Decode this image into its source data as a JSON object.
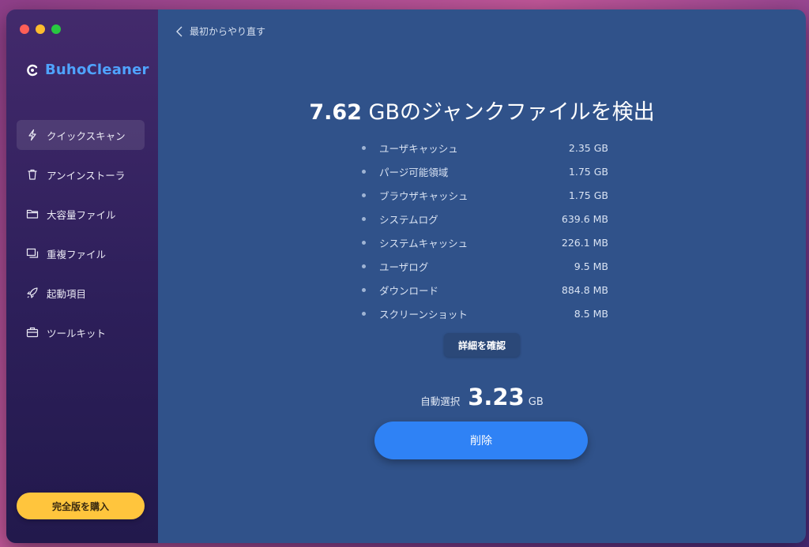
{
  "app": {
    "name": "BuhoCleaner"
  },
  "colors": {
    "brand": "#4fa3ff",
    "primary_button": "#2f82f5",
    "buy_button": "#ffc53d"
  },
  "sidebar": {
    "items": [
      {
        "label": "クイックスキャン",
        "icon": "pulse-icon",
        "active": true
      },
      {
        "label": "アンインストーラ",
        "icon": "trash-icon",
        "active": false
      },
      {
        "label": "大容量ファイル",
        "icon": "folder-icon",
        "active": false
      },
      {
        "label": "重複ファイル",
        "icon": "duplicate-icon",
        "active": false
      },
      {
        "label": "起動項目",
        "icon": "rocket-icon",
        "active": false
      },
      {
        "label": "ツールキット",
        "icon": "toolbox-icon",
        "active": false
      }
    ],
    "buy_label": "完全版を購入"
  },
  "main": {
    "back_label": "最初からやり直す",
    "headline_value": "7.62",
    "headline_text": " GBのジャンクファイルを検出",
    "junk_items": [
      {
        "name": "ユーザキャッシュ",
        "size": "2.35 GB"
      },
      {
        "name": "パージ可能領域",
        "size": "1.75 GB"
      },
      {
        "name": "ブラウザキャッシュ",
        "size": "1.75 GB"
      },
      {
        "name": "システムログ",
        "size": "639.6 MB"
      },
      {
        "name": "システムキャッシュ",
        "size": "226.1 MB"
      },
      {
        "name": "ユーザログ",
        "size": "9.5 MB"
      },
      {
        "name": "ダウンロード",
        "size": "884.8 MB"
      },
      {
        "name": "スクリーンショット",
        "size": "8.5 MB"
      }
    ],
    "details_label": "詳細を確認",
    "auto_select_label": "自動選択",
    "auto_select_value": "3.23",
    "auto_select_unit": "GB",
    "delete_label": "削除"
  }
}
